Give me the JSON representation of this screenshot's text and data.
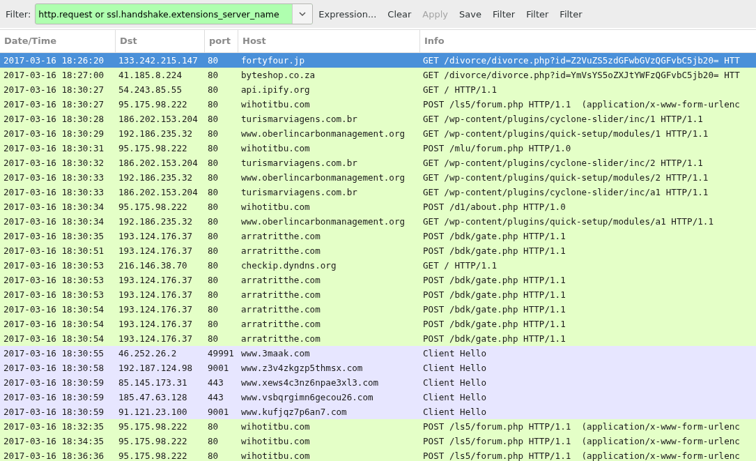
{
  "toolbar": {
    "filter_label": "Filter:",
    "filter_value": "http.request or ssl.handshake.extensions_server_name",
    "buttons": [
      {
        "label": "Expression...",
        "disabled": false
      },
      {
        "label": "Clear",
        "disabled": false
      },
      {
        "label": "Apply",
        "disabled": true
      },
      {
        "label": "Save",
        "disabled": false
      },
      {
        "label": "Filter",
        "disabled": false
      },
      {
        "label": "Filter",
        "disabled": false
      },
      {
        "label": "Filter",
        "disabled": false
      }
    ]
  },
  "table": {
    "columns": [
      "Date/Time",
      "Dst",
      "port",
      "Host",
      "Info"
    ],
    "rows": [
      {
        "kind": "http",
        "selected": true,
        "cells": [
          "2017-03-16 18:26:20",
          "133.242.215.147",
          "80",
          "fortyfour.jp",
          "GET /divorce/divorce.php?id=Z2VuZS5zdGFwbGVzQGFvbC5jb20= HTT"
        ]
      },
      {
        "kind": "http",
        "selected": false,
        "cells": [
          "2017-03-16 18:27:00",
          "41.185.8.224",
          "80",
          "byteshop.co.za",
          "GET /divorce/divorce.php?id=YmVsYS5oZXJtYWFzQGFvbC5jb20= HTT"
        ]
      },
      {
        "kind": "http",
        "selected": false,
        "cells": [
          "2017-03-16 18:30:27",
          "54.243.85.55",
          "80",
          "api.ipify.org",
          "GET / HTTP/1.1"
        ]
      },
      {
        "kind": "http",
        "selected": false,
        "cells": [
          "2017-03-16 18:30:27",
          "95.175.98.222",
          "80",
          "wihotitbu.com",
          "POST /ls5/forum.php HTTP/1.1  (application/x-www-form-urlenc"
        ]
      },
      {
        "kind": "http",
        "selected": false,
        "cells": [
          "2017-03-16 18:30:28",
          "186.202.153.204",
          "80",
          "turismarviagens.com.br",
          "GET /wp-content/plugins/cyclone-slider/inc/1 HTTP/1.1"
        ]
      },
      {
        "kind": "http",
        "selected": false,
        "cells": [
          "2017-03-16 18:30:29",
          "192.186.235.32",
          "80",
          "www.oberlincarbonmanagement.org",
          "GET /wp-content/plugins/quick-setup/modules/1 HTTP/1.1"
        ]
      },
      {
        "kind": "http",
        "selected": false,
        "cells": [
          "2017-03-16 18:30:31",
          "95.175.98.222",
          "80",
          "wihotitbu.com",
          "POST /mlu/forum.php HTTP/1.0"
        ]
      },
      {
        "kind": "http",
        "selected": false,
        "cells": [
          "2017-03-16 18:30:32",
          "186.202.153.204",
          "80",
          "turismarviagens.com.br",
          "GET /wp-content/plugins/cyclone-slider/inc/2 HTTP/1.1"
        ]
      },
      {
        "kind": "http",
        "selected": false,
        "cells": [
          "2017-03-16 18:30:33",
          "192.186.235.32",
          "80",
          "www.oberlincarbonmanagement.org",
          "GET /wp-content/plugins/quick-setup/modules/2 HTTP/1.1"
        ]
      },
      {
        "kind": "http",
        "selected": false,
        "cells": [
          "2017-03-16 18:30:33",
          "186.202.153.204",
          "80",
          "turismarviagens.com.br",
          "GET /wp-content/plugins/cyclone-slider/inc/a1 HTTP/1.1"
        ]
      },
      {
        "kind": "http",
        "selected": false,
        "cells": [
          "2017-03-16 18:30:34",
          "95.175.98.222",
          "80",
          "wihotitbu.com",
          "POST /d1/about.php HTTP/1.0"
        ]
      },
      {
        "kind": "http",
        "selected": false,
        "cells": [
          "2017-03-16 18:30:34",
          "192.186.235.32",
          "80",
          "www.oberlincarbonmanagement.org",
          "GET /wp-content/plugins/quick-setup/modules/a1 HTTP/1.1"
        ]
      },
      {
        "kind": "http",
        "selected": false,
        "cells": [
          "2017-03-16 18:30:35",
          "193.124.176.37",
          "80",
          "arratritthe.com",
          "POST /bdk/gate.php HTTP/1.1"
        ]
      },
      {
        "kind": "http",
        "selected": false,
        "cells": [
          "2017-03-16 18:30:51",
          "193.124.176.37",
          "80",
          "arratritthe.com",
          "POST /bdk/gate.php HTTP/1.1"
        ]
      },
      {
        "kind": "http",
        "selected": false,
        "cells": [
          "2017-03-16 18:30:53",
          "216.146.38.70",
          "80",
          "checkip.dyndns.org",
          "GET / HTTP/1.1"
        ]
      },
      {
        "kind": "http",
        "selected": false,
        "cells": [
          "2017-03-16 18:30:53",
          "193.124.176.37",
          "80",
          "arratritthe.com",
          "POST /bdk/gate.php HTTP/1.1"
        ]
      },
      {
        "kind": "http",
        "selected": false,
        "cells": [
          "2017-03-16 18:30:53",
          "193.124.176.37",
          "80",
          "arratritthe.com",
          "POST /bdk/gate.php HTTP/1.1"
        ]
      },
      {
        "kind": "http",
        "selected": false,
        "cells": [
          "2017-03-16 18:30:54",
          "193.124.176.37",
          "80",
          "arratritthe.com",
          "POST /bdk/gate.php HTTP/1.1"
        ]
      },
      {
        "kind": "http",
        "selected": false,
        "cells": [
          "2017-03-16 18:30:54",
          "193.124.176.37",
          "80",
          "arratritthe.com",
          "POST /bdk/gate.php HTTP/1.1"
        ]
      },
      {
        "kind": "http",
        "selected": false,
        "cells": [
          "2017-03-16 18:30:54",
          "193.124.176.37",
          "80",
          "arratritthe.com",
          "POST /bdk/gate.php HTTP/1.1"
        ]
      },
      {
        "kind": "tls",
        "selected": false,
        "cells": [
          "2017-03-16 18:30:55",
          "46.252.26.2",
          "49991",
          "www.3maak.com",
          "Client Hello"
        ]
      },
      {
        "kind": "tls",
        "selected": false,
        "cells": [
          "2017-03-16 18:30:58",
          "192.187.124.98",
          "9001",
          "www.z3v4zkgzp5thmsx.com",
          "Client Hello"
        ]
      },
      {
        "kind": "tls",
        "selected": false,
        "cells": [
          "2017-03-16 18:30:59",
          "85.145.173.31",
          "443",
          "www.xews4c3nz6npae3xl3.com",
          "Client Hello"
        ]
      },
      {
        "kind": "tls",
        "selected": false,
        "cells": [
          "2017-03-16 18:30:59",
          "185.47.63.128",
          "443",
          "www.vsbqrgimn6gecou26.com",
          "Client Hello"
        ]
      },
      {
        "kind": "tls",
        "selected": false,
        "cells": [
          "2017-03-16 18:30:59",
          "91.121.23.100",
          "9001",
          "www.kufjqz7p6an7.com",
          "Client Hello"
        ]
      },
      {
        "kind": "http",
        "selected": false,
        "cells": [
          "2017-03-16 18:32:35",
          "95.175.98.222",
          "80",
          "wihotitbu.com",
          "POST /ls5/forum.php HTTP/1.1  (application/x-www-form-urlenc"
        ]
      },
      {
        "kind": "http",
        "selected": false,
        "cells": [
          "2017-03-16 18:34:35",
          "95.175.98.222",
          "80",
          "wihotitbu.com",
          "POST /ls5/forum.php HTTP/1.1  (application/x-www-form-urlenc"
        ]
      },
      {
        "kind": "http",
        "selected": false,
        "cells": [
          "2017-03-16 18:36:36",
          "95.175.98.222",
          "80",
          "wihotitbu.com",
          "POST /ls5/forum.php HTTP/1.1  (application/x-www-form-urlenc"
        ]
      }
    ]
  }
}
